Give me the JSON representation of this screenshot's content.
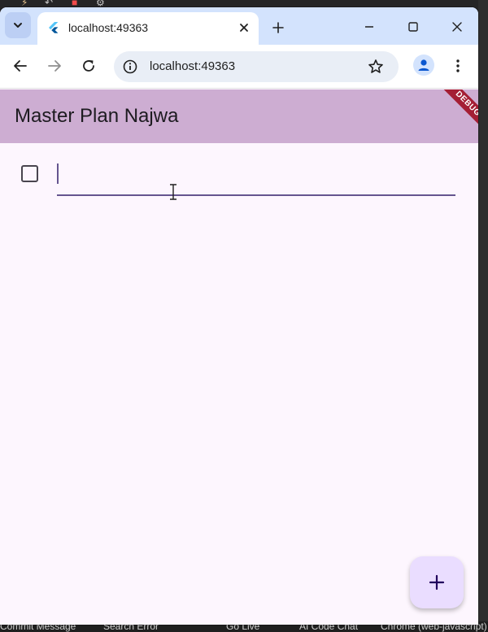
{
  "browser": {
    "tab": {
      "title": "localhost:49363"
    },
    "address_bar": {
      "url": "localhost:49363"
    }
  },
  "app": {
    "app_bar": {
      "title": "Master Plan Najwa",
      "debug_banner": "DEBUG"
    },
    "tasks": [
      {
        "completed": false,
        "description": ""
      }
    ],
    "fab": {
      "icon": "plus-icon"
    }
  },
  "background_ide": {
    "status_items": [
      "Commit Message",
      "Search Error",
      "Go Live",
      "AI Code Chat",
      "Chrome (web-javascript)"
    ]
  },
  "colors": {
    "app_bar": "#cdadd2",
    "app_background": "#fdf6fe",
    "fab": "#eaddff",
    "accent": "#65558f",
    "debug_banner": "#a41e34",
    "tabstrip": "#d3e3fd"
  }
}
